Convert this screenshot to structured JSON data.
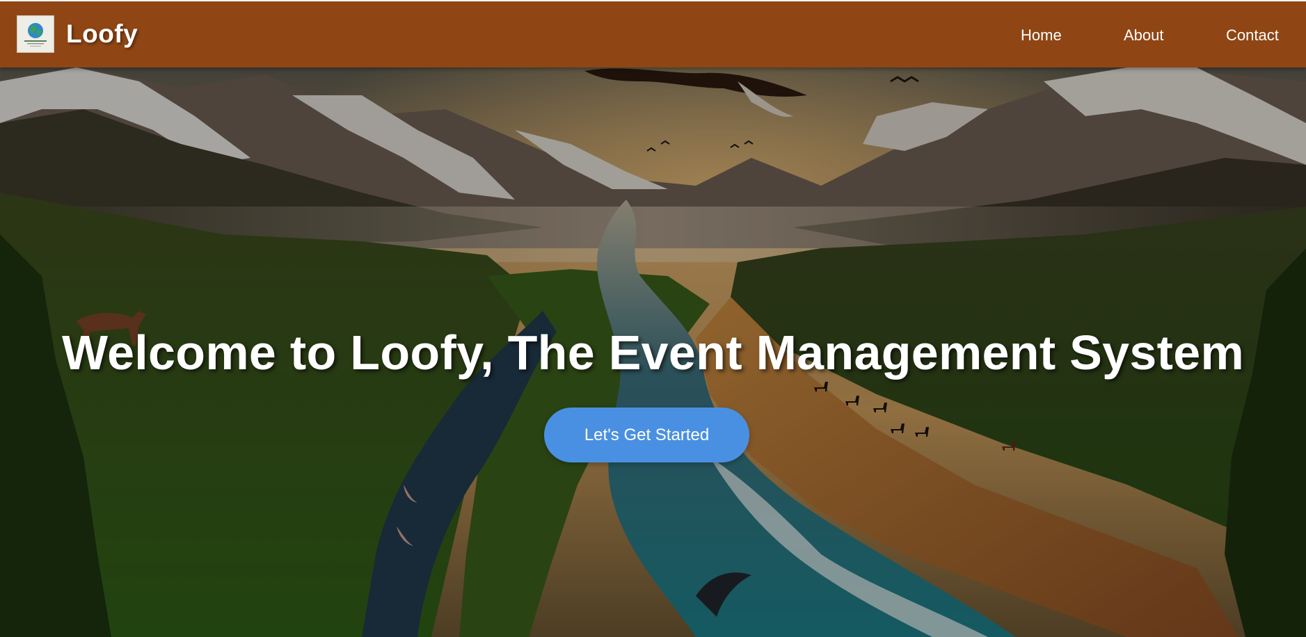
{
  "brand": {
    "name": "Loofy",
    "logo_icon": "earth-globe-logo-icon"
  },
  "nav": {
    "items": [
      {
        "label": "Home"
      },
      {
        "label": "About"
      },
      {
        "label": "Contact"
      }
    ]
  },
  "hero": {
    "title": "Welcome to Loofy, The Event Management System",
    "cta_label": "Let's Get Started",
    "background": "nature-landscape-image"
  },
  "colors": {
    "navbar": "#8f4614",
    "cta": "#4a90e2",
    "text": "#ffffff"
  }
}
